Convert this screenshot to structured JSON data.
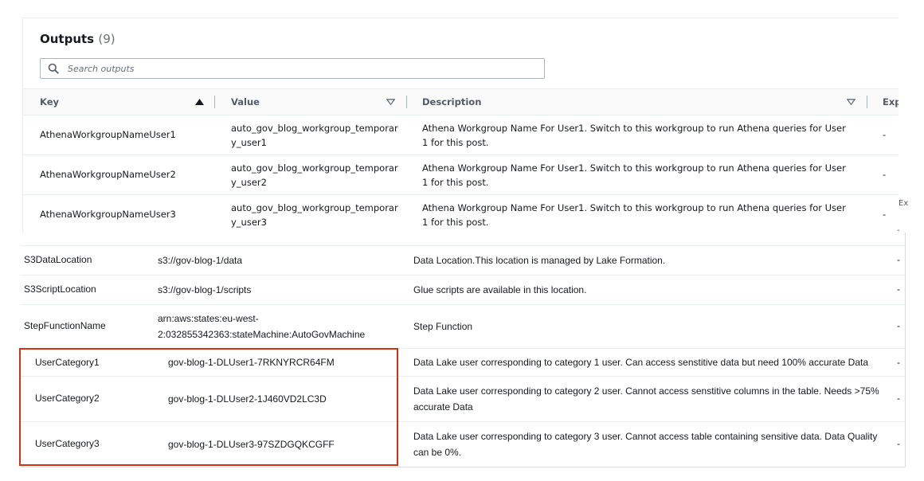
{
  "header": {
    "title": "Outputs",
    "count": "(9)"
  },
  "search": {
    "placeholder": "Search outputs"
  },
  "columns": {
    "key": "Key",
    "value": "Value",
    "description": "Description",
    "export": "Exp"
  },
  "top_rows": [
    {
      "key": "AthenaWorkgroupNameUser1",
      "value": "auto_gov_blog_workgroup_temporary_user1",
      "description": "Athena Workgroup Name For User1. Switch to this workgroup to run Athena queries for User 1 for this post.",
      "export": "-"
    },
    {
      "key": "AthenaWorkgroupNameUser2",
      "value": "auto_gov_blog_workgroup_temporary_user2",
      "description": "Athena Workgroup Name For User1. Switch to this workgroup to run Athena queries for User 1 for this post.",
      "export": "-"
    },
    {
      "key": "AthenaWorkgroupNameUser3",
      "value": "auto_gov_blog_workgroup_temporary_user3",
      "description": "Athena Workgroup Name For User1. Switch to this workgroup to run Athena queries for User 1 for this post.",
      "export": "-"
    }
  ],
  "side_fragment": "Ex",
  "side_dash": "-",
  "bottom_rows": [
    {
      "key": "S3DataLocation",
      "value": "s3://gov-blog-1/data",
      "description": "Data Location.This location is managed by Lake Formation.",
      "export": "-"
    },
    {
      "key": "S3ScriptLocation",
      "value": "s3://gov-blog-1/scripts",
      "description": "Glue scripts are available in this location.",
      "export": "-"
    },
    {
      "key": "StepFunctionName",
      "value": "arn:aws:states:eu-west-2:032855342363:stateMachine:AutoGovMachine",
      "description": "Step Function",
      "export": "-"
    },
    {
      "key": "UserCategory1",
      "value": "gov-blog-1-DLUser1-7RKNYRCR64FM",
      "description": "Data Lake user corresponding to category 1 user. Can access senstitive data but need 100% accurate Data",
      "export": "-"
    },
    {
      "key": "UserCategory2",
      "value": "gov-blog-1-DLUser2-1J460VD2LC3D",
      "description": "Data Lake user corresponding to category 2 user. Cannot access senstitive columns in the table. Needs >75% accurate Data",
      "export": "-"
    },
    {
      "key": "UserCategory3",
      "value": "gov-blog-1-DLUser3-97SZDGQKCGFF",
      "description": "Data Lake user corresponding to category 3 user. Cannot access table containing sensitive data. Data Quality can be 0%.",
      "export": "-"
    }
  ],
  "colors": {
    "highlight": "#d13212",
    "header_bg": "#fafafa",
    "text": "#16191f",
    "muted": "#545b64"
  },
  "icons": {
    "search": "search-icon",
    "sort_asc": "caret-up-filled-icon",
    "sort_none": "caret-down-outline-icon"
  }
}
